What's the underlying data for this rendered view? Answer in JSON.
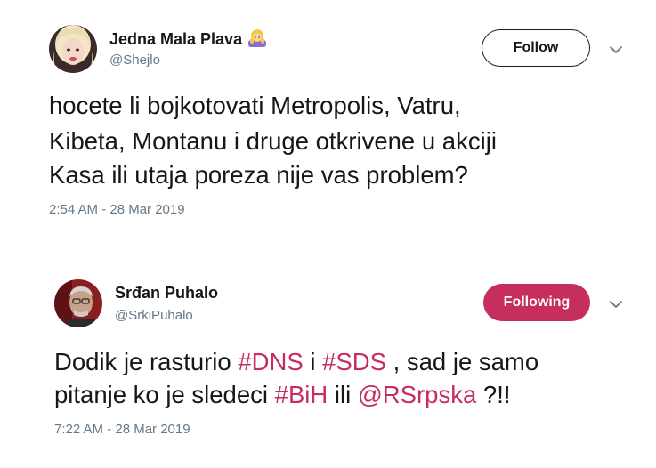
{
  "tweets": [
    {
      "author_name": "Jedna Mala Plava",
      "author_handle": "@Shejlo",
      "name_emoji": "woman-bowing-blonde-emoji",
      "follow_label": "Follow",
      "lines": [
        "hocete li bojkotovati Metropolis, Vatru,",
        "Kibeta, Montanu i druge otkrivene u akciji",
        "Kasa ili utaja poreza nije vas problem?"
      ],
      "timestamp": "2:54 AM - 28 Mar 2019"
    },
    {
      "author_name": "Srđan Puhalo",
      "author_handle": "@SrkiPuhalo",
      "follow_label": "Following",
      "line1": {
        "p1": "Dodik je rasturio ",
        "tag1": "#DNS",
        "p2": " i ",
        "tag2": "#SDS",
        "p3": " , sad je samo"
      },
      "line2": {
        "p1": "pitanje ko je sledeci ",
        "tag1": "#BiH",
        "p2": " ili ",
        "tag2": "@RSrpska",
        "p3": " ?!!"
      },
      "timestamp": "7:22 AM - 28 Mar 2019"
    }
  ],
  "colors": {
    "accent": "#c52e5d",
    "text": "#14171a",
    "muted": "#657786"
  }
}
